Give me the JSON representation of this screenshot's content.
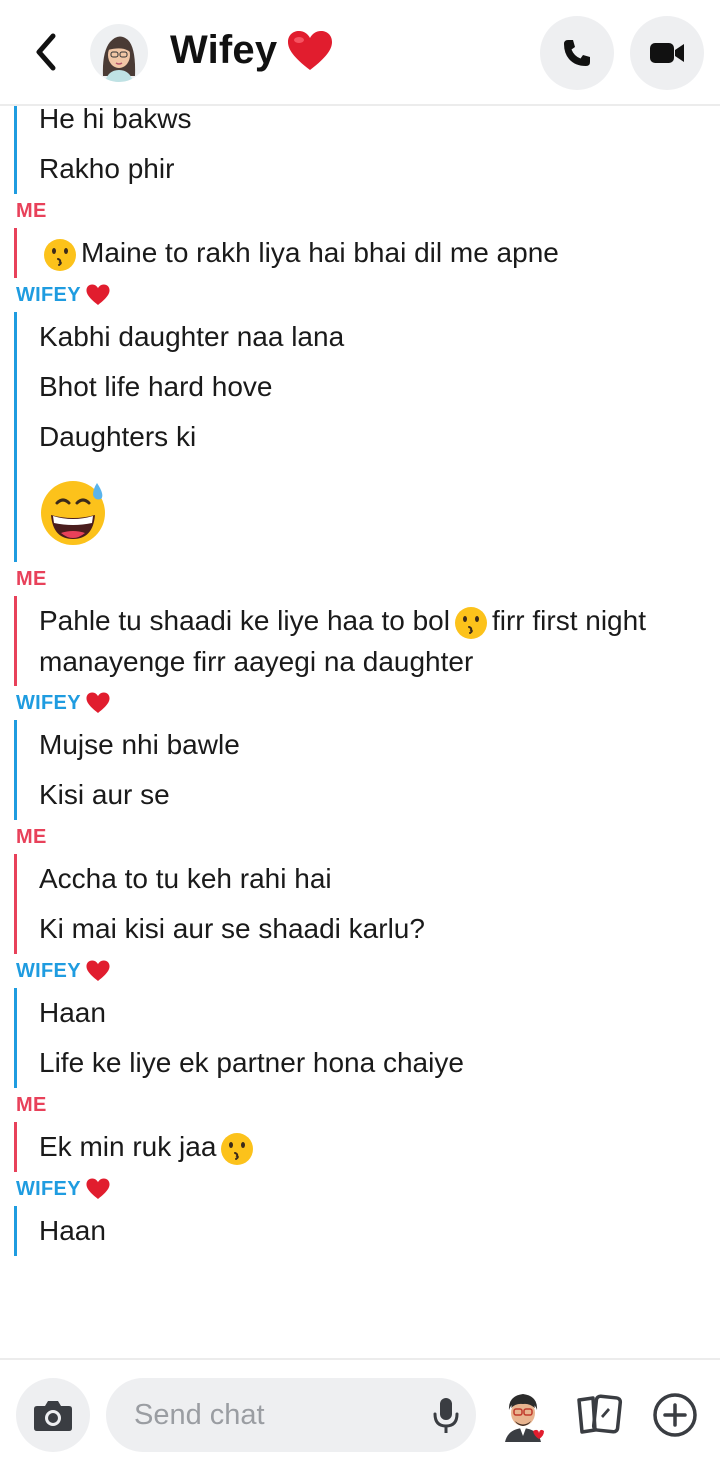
{
  "header": {
    "title": "Wifey",
    "back_icon": "chevron-left-icon",
    "call_icon": "phone-icon",
    "video_icon": "video-camera-icon"
  },
  "colors": {
    "me": "#e8415a",
    "wifey": "#1f9ce0",
    "heart": "#e11d2e"
  },
  "messages": [
    {
      "sender": "",
      "side": "wifey",
      "lines": [
        "He hi bakws",
        "Rakho phir"
      ]
    },
    {
      "sender": "ME",
      "side": "me",
      "lines": [
        "Maine to rakh liya hai bhai dil me apne"
      ]
    },
    {
      "sender": "WIFEY",
      "side": "wifey",
      "lines": [
        "Kabhi daughter naa lana",
        "Bhot life hard hove",
        "Daughters ki"
      ]
    },
    {
      "sender": "ME",
      "side": "me",
      "lines": [
        "Pahle tu shaadi ke liye haa to bol",
        "firr first night manayenge firr aayegi na daughter"
      ]
    },
    {
      "sender": "WIFEY",
      "side": "wifey",
      "lines": [
        "Mujse nhi bawle",
        "Kisi aur se"
      ]
    },
    {
      "sender": "ME",
      "side": "me",
      "lines": [
        "Accha to tu keh rahi hai",
        "Ki mai kisi aur se shaadi karlu?"
      ]
    },
    {
      "sender": "WIFEY",
      "side": "wifey",
      "lines": [
        "Haan",
        "Life ke liye ek partner hona chaiye"
      ]
    },
    {
      "sender": "ME",
      "side": "me",
      "lines": [
        "Ek min ruk jaa"
      ]
    },
    {
      "sender": "WIFEY",
      "side": "wifey",
      "lines": [
        "Haan"
      ]
    }
  ],
  "composer": {
    "placeholder": "Send chat",
    "camera_icon": "camera-icon",
    "mic_icon": "microphone-icon",
    "bitmoji_icon": "bitmoji-icon",
    "cards_icon": "cards-icon",
    "plus_icon": "plus-circle-icon"
  }
}
